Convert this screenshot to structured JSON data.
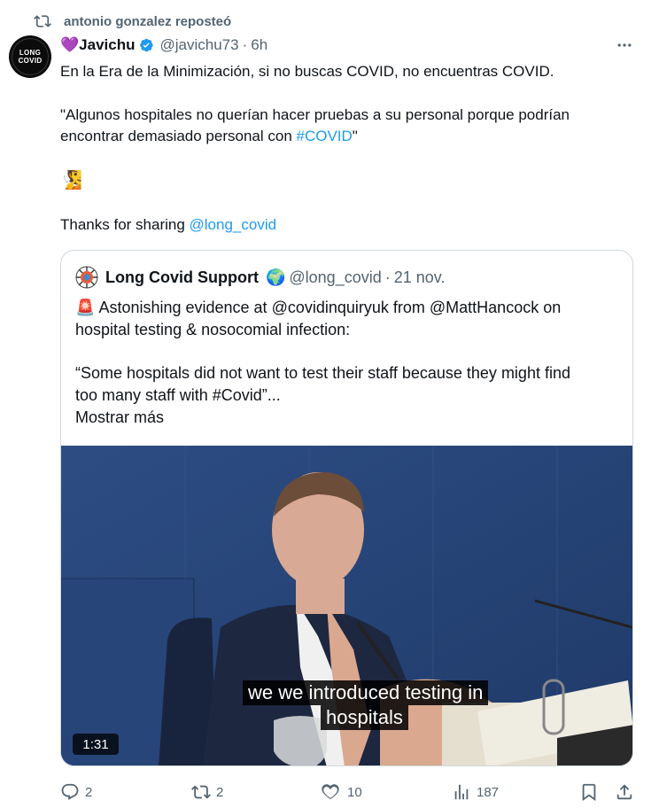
{
  "repost": {
    "text": "antonio gonzalez reposteó"
  },
  "author": {
    "emoji": "💜",
    "name": "Javichu",
    "handle": "@javichu73",
    "separator": "·",
    "time": "6h",
    "avatar_text": [
      "LONG",
      "COVID"
    ]
  },
  "tweet": {
    "line1": "En la Era de la Minimización, si no buscas COVID, no encuentras COVID.",
    "quote_line1": "\"Algunos hospitales no querían hacer pruebas a su personal porque podrían",
    "quote_line2_prefix": "encontrar demasiado personal con ",
    "quote_line2_hashtag": "#COVID",
    "quote_line2_suffix": "\"",
    "emoji": "🧏",
    "thanks_prefix": "Thanks for sharing ",
    "thanks_mention": "@long_covid"
  },
  "quoted": {
    "name": "Long Covid Support",
    "globe_emoji": "🌍",
    "handle": "@long_covid",
    "separator": "·",
    "time": "21 nov.",
    "siren_emoji": "🚨",
    "line1": "Astonishing evidence at @covidinquiryuk from @MattHancock on",
    "line2": "hospital testing & nosocomial infection:",
    "line3": "“Some hospitals did not want to test their staff because they might find",
    "line4": "too many staff with #Covid”...",
    "show_more": "Mostrar más",
    "video": {
      "duration": "1:31",
      "subtitle_line1": "we we introduced testing in",
      "subtitle_line2": "hospitals"
    }
  },
  "actions": {
    "replies": "2",
    "reposts": "2",
    "likes": "10",
    "views": "187"
  },
  "colors": {
    "link": "#1d9bf0",
    "muted": "#536471",
    "verified": "#1d9bf0",
    "border": "#cfd9de"
  }
}
